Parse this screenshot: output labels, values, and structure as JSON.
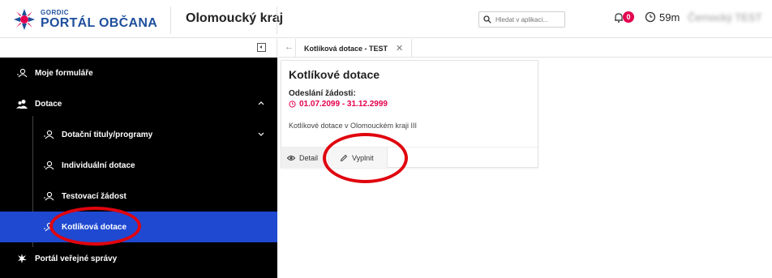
{
  "header": {
    "logo_sub": "GORDIC",
    "logo_main": "PORTÁL OBČANA",
    "region": "Olomoucký kraj",
    "search_placeholder": "Hledat v aplikaci...",
    "notifications_count": "0",
    "session_timer": "59m",
    "user_name": "Černocký TEST"
  },
  "sidebar": {
    "items": [
      {
        "label": "Moje formuláře",
        "icon": "person-icon"
      },
      {
        "label": "Dotace",
        "icon": "people-icon"
      },
      {
        "label": "Dotační tituly/programy",
        "icon": "person-icon"
      },
      {
        "label": "Individuální dotace",
        "icon": "person-icon"
      },
      {
        "label": "Testovací žádost",
        "icon": "person-icon"
      },
      {
        "label": "Kotlíková dotace",
        "icon": "person-icon"
      },
      {
        "label": "Portál veřejné správy",
        "icon": "emblem-icon"
      }
    ]
  },
  "tabs": {
    "back": "←",
    "active_tab": "Kotlíková dotace - TEST",
    "close": "✕"
  },
  "card": {
    "title": "Kotlíkové dotace",
    "label": "Odeslání žádosti:",
    "date_range": "01.07.2099 - 31.12.2999",
    "description": "Kotlíkové dotace v Olomouckém kraji III",
    "detail_label": "Detail",
    "fill_label": "Vyplnit"
  },
  "colors": {
    "active_item": "#1f49d1",
    "accent": "#e3004f",
    "annotation": "#e0050e",
    "brand": "#1e4f9c"
  }
}
